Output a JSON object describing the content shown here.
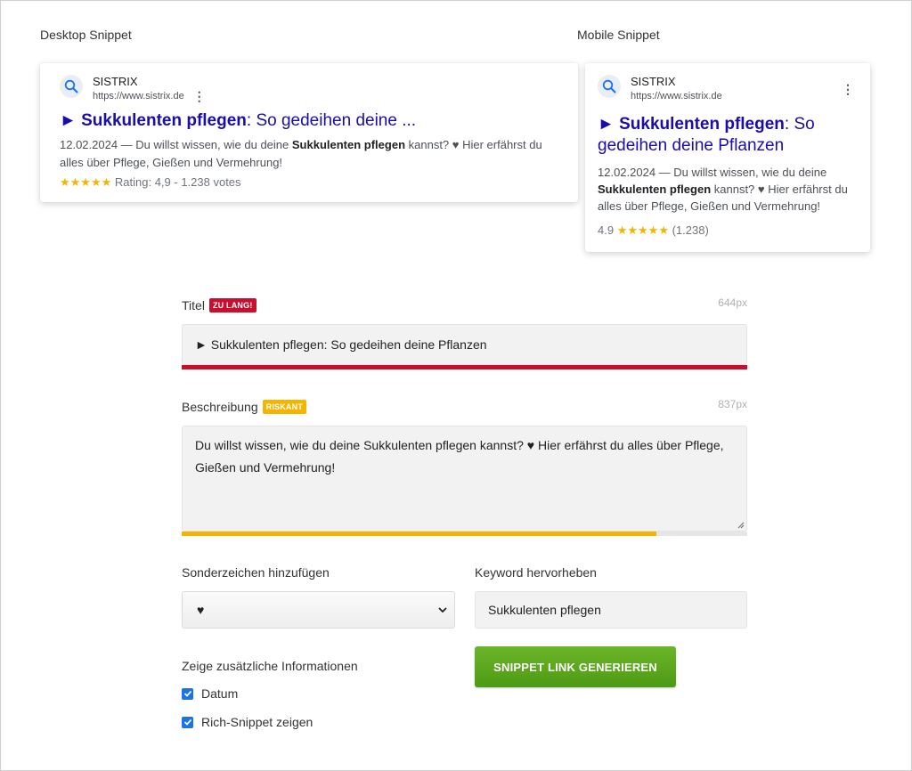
{
  "desktop": {
    "label": "Desktop Snippet",
    "site_name": "SISTRIX",
    "url": "https://www.sistrix.de",
    "title_prefix": "► ",
    "title_bold": "Sukkulenten pflegen",
    "title_rest": ": So gedeihen deine ...",
    "desc_pre": "12.02.2024 — Du willst wissen, wie du deine ",
    "desc_bold": "Sukkulenten pflegen",
    "desc_post": " kannst? ♥ Hier erfährst du alles über Pflege, Gießen und Vermehrung!",
    "stars": "★★★★★",
    "rating_text": " Rating: 4,9 - 1.238 votes"
  },
  "mobile": {
    "label": "Mobile Snippet",
    "site_name": "SISTRIX",
    "url": "https://www.sistrix.de",
    "title_prefix": "► ",
    "title_bold": "Sukkulenten pflegen",
    "title_rest": ": So gedeihen deine Pflanzen",
    "desc_pre": "12.02.2024 — Du willst wissen, wie du deine ",
    "desc_bold": "Sukkulenten pflegen",
    "desc_post": " kannst? ♥ Hier erfährst du alles über Pflege, Gießen und Vermehrung!",
    "rating_value": "4.9",
    "stars": "★★★★★",
    "rating_count": " (1.238)"
  },
  "form": {
    "title_label": "Titel",
    "title_badge": "ZU LANG!",
    "title_px": "644px",
    "title_value": "► Sukkulenten pflegen: So gedeihen deine Pflanzen",
    "title_progress": 1.0,
    "desc_label": "Beschreibung",
    "desc_badge": "RISKANT",
    "desc_px": "837px",
    "desc_value": "Du willst wissen, wie du deine Sukkulenten pflegen kannst? ♥ Hier erfährst du alles über Pflege, Gießen und Vermehrung!",
    "desc_progress": 0.84,
    "special_label": "Sonderzeichen hinzufügen",
    "special_value": "♥",
    "keyword_label": "Keyword hervorheben",
    "keyword_value": "Sukkulenten pflegen",
    "extra_label": "Zeige zusätzliche Informationen",
    "checkbox_date": "Datum",
    "checkbox_rich": "Rich-Snippet zeigen",
    "generate_button": "SNIPPET LINK GENERIEREN"
  },
  "colors": {
    "too_long": "#c8102e",
    "risky": "#f4b400",
    "button": "#5aa61c",
    "link": "#1a0dab"
  }
}
